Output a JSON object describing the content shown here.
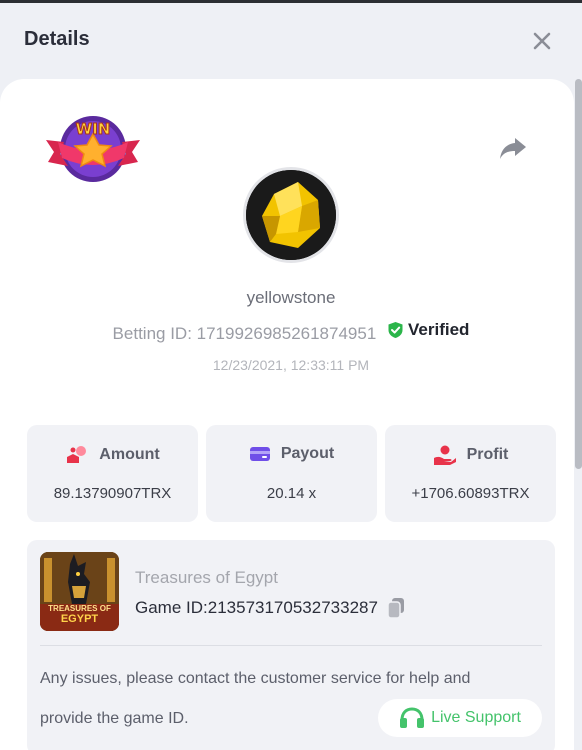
{
  "header": {
    "title": "Details"
  },
  "profile": {
    "username": "yellowstone",
    "betting_id_label": "Betting ID: 1719926985261874951",
    "verified_label": "Verified",
    "timestamp": "12/23/2021, 12:33:11 PM",
    "badge_text": "WIN"
  },
  "stats": [
    {
      "label": "Amount",
      "value": "89.13790907TRX"
    },
    {
      "label": "Payout",
      "value": "20.14 x"
    },
    {
      "label": "Profit",
      "value": "+1706.60893TRX"
    }
  ],
  "game": {
    "name": "Treasures of Egypt",
    "game_id_label": "Game ID:",
    "game_id": "213573170532733287",
    "thumb_text_line1": "TREASURES OF",
    "thumb_text_line2": "EGYPT"
  },
  "support": {
    "notice_line1": "Any issues, please contact the customer service for help and",
    "notice_line2": "provide the game ID.",
    "button_label": "Live Support"
  },
  "colors": {
    "verified": "#2bb54a",
    "accent_red": "#e8334a",
    "accent_purple": "#6f4ee8",
    "support_green": "#44c36b"
  }
}
